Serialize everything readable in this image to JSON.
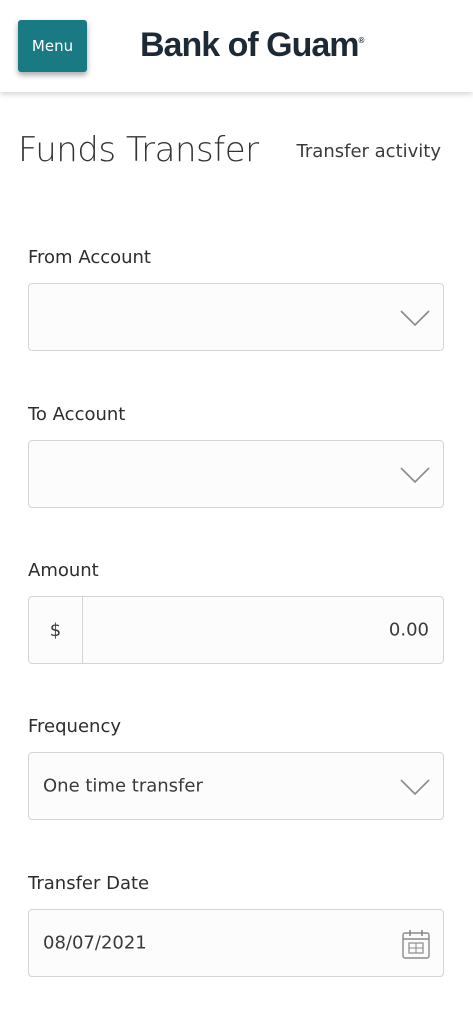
{
  "header": {
    "menu_label": "Menu",
    "logo_text": "Bank of Guam",
    "logo_mark": "®"
  },
  "page": {
    "title": "Funds Transfer",
    "activity_link": "Transfer activity"
  },
  "form": {
    "from_account": {
      "label": "From Account",
      "value": ""
    },
    "to_account": {
      "label": "To Account",
      "value": ""
    },
    "amount": {
      "label": "Amount",
      "currency": "$",
      "value": "0.00"
    },
    "frequency": {
      "label": "Frequency",
      "value": "One time transfer"
    },
    "transfer_date": {
      "label": "Transfer Date",
      "value": "08/07/2021"
    }
  },
  "icons": {
    "dropdown": "chevron-down-icon",
    "date": "calendar-icon"
  },
  "colors": {
    "menu_button": "#1a7a83",
    "logo": "#1d2a35",
    "border": "#d4d4d4"
  }
}
